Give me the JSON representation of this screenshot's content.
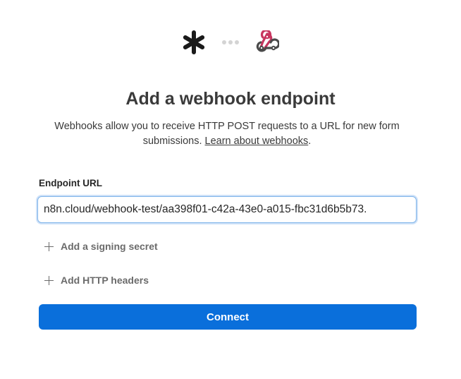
{
  "header": {
    "left_icon": "asterisk-icon",
    "right_icon": "webhook-icon",
    "connector": "dots"
  },
  "title": "Add a webhook endpoint",
  "description": {
    "text": "Webhooks allow you to receive HTTP POST requests to a URL for new form submissions.",
    "link_text": "Learn about webhooks",
    "suffix": "."
  },
  "endpoint": {
    "label": "Endpoint URL",
    "value": ".n8n.cloud/webhook-test/aa398f01-c42a-43e0-a015-fbc31d6b5b73"
  },
  "options": {
    "signing_secret": "Add a signing secret",
    "http_headers": "Add HTTP headers"
  },
  "connect_label": "Connect",
  "colors": {
    "primary": "#0a6fdb",
    "webhook_pink": "#c7365f",
    "webhook_dark": "#4a4a4a"
  }
}
